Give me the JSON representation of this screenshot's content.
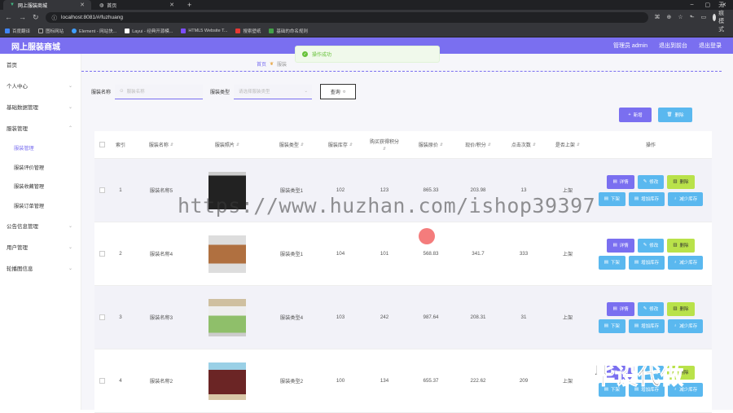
{
  "browser": {
    "tabs": [
      {
        "title": "网上服装商城",
        "active": true
      },
      {
        "title": "首页",
        "active": false
      }
    ],
    "url": "localhost:8081/#/fuzhuang",
    "profile_label": "无痕模式",
    "bookmarks": [
      "百度翻译",
      "图标网站",
      "Element - 网站快...",
      "Layui - 经典开源模...",
      "HTML5 Website T...",
      "搜索壁纸",
      "基础的命名规则"
    ]
  },
  "header": {
    "title": "网上服装商城",
    "links": [
      "管理员 admin",
      "退出到前台",
      "退出登录"
    ]
  },
  "sidebar": {
    "items": [
      {
        "label": "首页",
        "arrow": false
      },
      {
        "label": "个人中心",
        "arrow": true
      },
      {
        "label": "基础数据管理",
        "arrow": true
      },
      {
        "label": "服装管理",
        "arrow": true
      }
    ],
    "subitems": [
      "服装管理",
      "服装评价管理",
      "服装收藏管理",
      "服装订单管理"
    ],
    "items_after": [
      {
        "label": "公告信息管理",
        "arrow": true
      },
      {
        "label": "用户管理",
        "arrow": true
      },
      {
        "label": "轮播图信息",
        "arrow": true
      }
    ]
  },
  "breadcrumb": {
    "home": "首页",
    "current": "服装"
  },
  "toast": {
    "message": "操作成功"
  },
  "search": {
    "name_label": "服装名称",
    "name_placeholder": "服装名称",
    "type_label": "服装类型",
    "type_placeholder": "请选择服装类型",
    "query_label": "查询"
  },
  "actions": {
    "add": "新增",
    "delete": "删除"
  },
  "table": {
    "headers": [
      "索引",
      "服装名称",
      "服装照片",
      "服装类型",
      "服装库存",
      "购买获得积分",
      "服装原价",
      "现价/积分",
      "点击次数",
      "是否上架",
      "操作"
    ],
    "rows": [
      {
        "index": "1",
        "name": "服装名称5",
        "type": "服装类型1",
        "stock": "102",
        "points": "123",
        "orig": "865.33",
        "price": "203.98",
        "clicks": "13",
        "status": "上架"
      },
      {
        "index": "2",
        "name": "服装名称4",
        "type": "服装类型1",
        "stock": "104",
        "points": "101",
        "orig": "568.83",
        "price": "341.7",
        "clicks": "333",
        "status": "上架"
      },
      {
        "index": "3",
        "name": "服装名称3",
        "type": "服装类型4",
        "stock": "103",
        "points": "242",
        "orig": "987.64",
        "price": "208.31",
        "clicks": "31",
        "status": "上架"
      },
      {
        "index": "4",
        "name": "服装名称2",
        "type": "服装类型2",
        "stock": "100",
        "points": "134",
        "orig": "655.37",
        "price": "222.62",
        "clicks": "209",
        "status": "上架"
      }
    ],
    "row_buttons": [
      "详情",
      "修改",
      "删除",
      "下架",
      "增加库存",
      "减少库存"
    ]
  },
  "overlay": {
    "watermark": "https://www.huzhan.com/ishop39397",
    "badge": "毕设代做"
  },
  "colors": {
    "accent": "#7a6ff0",
    "info": "#5ab8ef",
    "lime": "#b9e24a",
    "success": "#67c23a"
  }
}
